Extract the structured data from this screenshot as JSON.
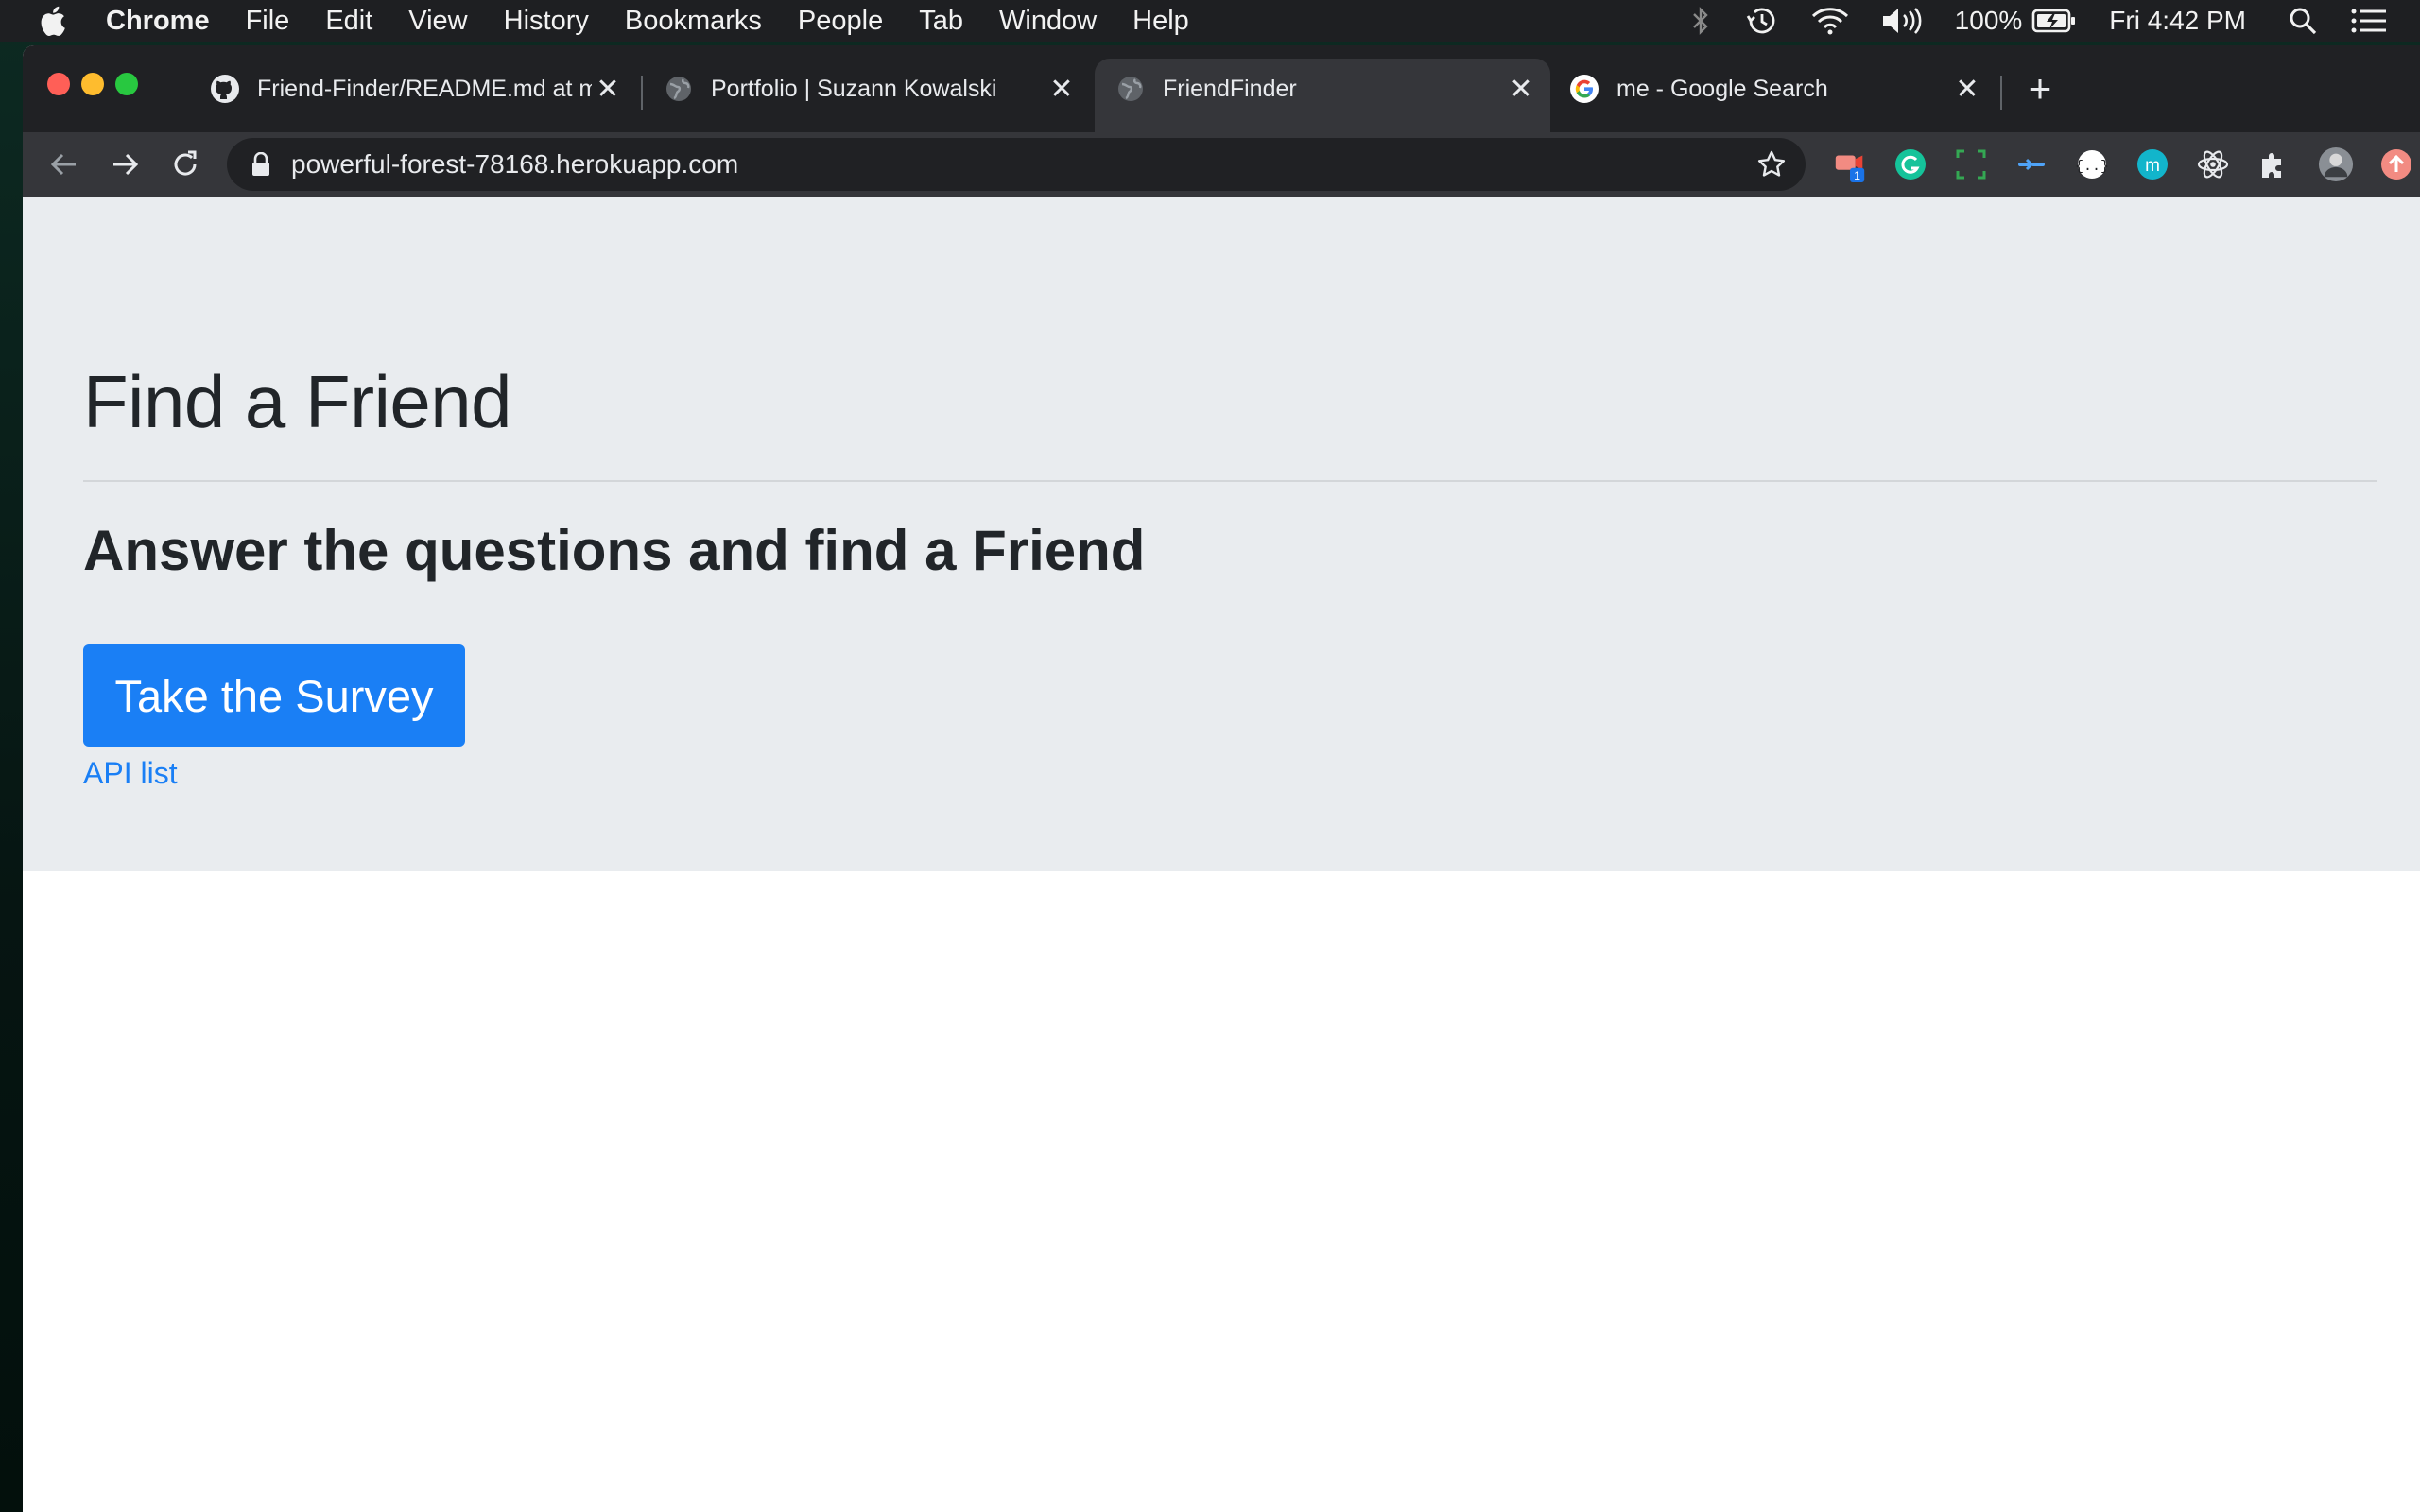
{
  "menubar": {
    "app": "Chrome",
    "items": [
      "File",
      "Edit",
      "View",
      "History",
      "Bookmarks",
      "People",
      "Tab",
      "Window",
      "Help"
    ],
    "battery": "100%",
    "clock": "Fri 4:42 PM"
  },
  "tabs": [
    {
      "title": "Friend-Finder/README.md at m",
      "favicon": "github-icon",
      "active": false
    },
    {
      "title": "Portfolio | Suzann Kowalski",
      "favicon": "globe-icon",
      "active": false
    },
    {
      "title": "FriendFinder",
      "favicon": "globe-icon",
      "active": true
    },
    {
      "title": "me - Google Search",
      "favicon": "google-icon",
      "active": false
    }
  ],
  "toolbar": {
    "url": "powerful-forest-78168.herokuapp.com",
    "extension_badge": "1"
  },
  "page": {
    "headline": "Find a Friend",
    "lead": "Answer the questions and find a Friend",
    "survey_button": "Take the Survey",
    "api_link": "API list"
  },
  "colors": {
    "jumbotron_bg": "#e9ecef",
    "primary": "#1a7ff5",
    "chrome_dark": "#202124",
    "chrome_toolbar": "#35363a"
  }
}
